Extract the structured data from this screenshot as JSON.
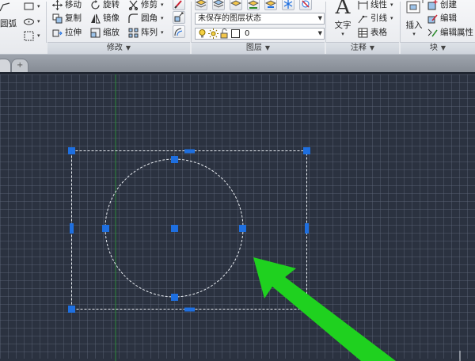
{
  "ribbon": {
    "draw": {
      "arc_label": "圆弧"
    },
    "modify": {
      "title": "修改",
      "move": "移动",
      "rotate": "旋转",
      "trim": "修剪",
      "copy": "复制",
      "mirror": "镜像",
      "fillet": "圆角",
      "stretch": "拉伸",
      "scale": "缩放",
      "array": "阵列"
    },
    "layers": {
      "title": "图层",
      "state_combo": "未保存的图层状态",
      "layer_combo": "0"
    },
    "annotation": {
      "title": "注释",
      "text": "文字",
      "linear": "线性",
      "leader": "引线",
      "table": "表格"
    },
    "block": {
      "title": "块",
      "insert": "插入",
      "create": "创建",
      "edit": "编辑",
      "edit_attributes": "编辑属性"
    }
  },
  "colors": {
    "canvas_bg": "#2b3240",
    "grip": "#1e6fe0",
    "arrow": "#1fd11f",
    "y_axis": "#2e8b3a"
  }
}
